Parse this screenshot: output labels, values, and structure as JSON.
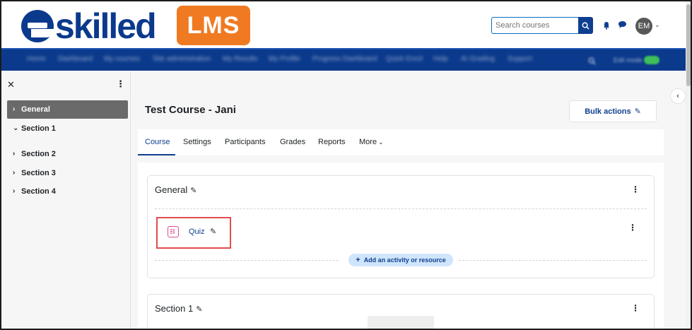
{
  "brand": {
    "name": "eskilled",
    "product": "LMS",
    "primary_color": "#0b3a8c",
    "accent_color": "#f07a22"
  },
  "header": {
    "search": {
      "placeholder": "Search courses"
    },
    "user": {
      "initials": "EM"
    }
  },
  "nav": {
    "items": [
      "Home",
      "Dashboard",
      "My courses",
      "Site administration",
      "My Results",
      "My Profile",
      "Progress Dashboard",
      "Quick Enrol",
      "Help",
      "AI Grading",
      "Support"
    ],
    "edit_mode_label": "Edit mode"
  },
  "sidebar": {
    "items": [
      {
        "label": "General",
        "active": true,
        "expanded": false
      },
      {
        "label": "Section 1",
        "active": false,
        "expanded": true
      },
      {
        "label": "Section 2",
        "active": false,
        "expanded": false
      },
      {
        "label": "Section 3",
        "active": false,
        "expanded": false
      },
      {
        "label": "Section 4",
        "active": false,
        "expanded": false
      }
    ]
  },
  "course": {
    "title": "Test Course - Jani",
    "bulk_actions": "Bulk actions",
    "tabs": [
      "Course",
      "Settings",
      "Participants",
      "Grades",
      "Reports",
      "More"
    ],
    "active_tab": "Course"
  },
  "sections": [
    {
      "title": "General",
      "activities": [
        {
          "name": "Quiz",
          "type": "quiz"
        }
      ],
      "add_label": "Add an activity or resource"
    },
    {
      "title": "Section 1"
    }
  ]
}
